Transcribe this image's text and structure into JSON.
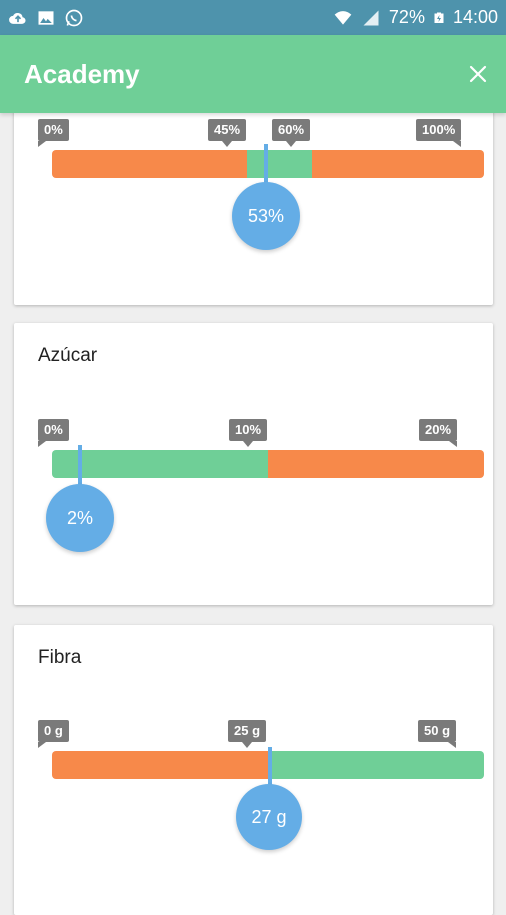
{
  "status_bar": {
    "battery": "72%",
    "time": "14:00",
    "icons": [
      "cloud-upload-icon",
      "image-icon",
      "whatsapp-icon",
      "wifi-icon",
      "signal-icon",
      "battery-charging-icon"
    ]
  },
  "app_bar": {
    "title": "Academy",
    "close_icon": "close-icon"
  },
  "cards": [
    {
      "title": "",
      "ticks": [
        "0%",
        "45%",
        "60%",
        "100%"
      ],
      "value_label": "53%",
      "value_fraction": 0.53,
      "segments": [
        {
          "color": "#f7894a",
          "from": 0,
          "to": 0.45
        },
        {
          "color": "#6fcf97",
          "from": 0.45,
          "to": 0.6
        },
        {
          "color": "#f7894a",
          "from": 0.6,
          "to": 1.0
        }
      ]
    },
    {
      "title": "Azúcar",
      "ticks": [
        "0%",
        "10%",
        "20%"
      ],
      "value_label": "2%",
      "value_fraction": 0.1,
      "segments": [
        {
          "color": "#6fcf97",
          "from": 0,
          "to": 0.5
        },
        {
          "color": "#f7894a",
          "from": 0.5,
          "to": 1.0
        }
      ]
    },
    {
      "title": "Fibra",
      "ticks": [
        "0 g",
        "25 g",
        "50 g"
      ],
      "value_label": "27 g",
      "value_fraction": 0.54,
      "segments": [
        {
          "color": "#f7894a",
          "from": 0,
          "to": 0.5
        },
        {
          "color": "#6fcf97",
          "from": 0.5,
          "to": 1.0
        }
      ]
    }
  ],
  "colors": {
    "app_bar": "#6fcf97",
    "status_bar": "#4e93ac",
    "orange": "#f7894a",
    "green": "#6fcf97",
    "marker": "#64ade6"
  }
}
